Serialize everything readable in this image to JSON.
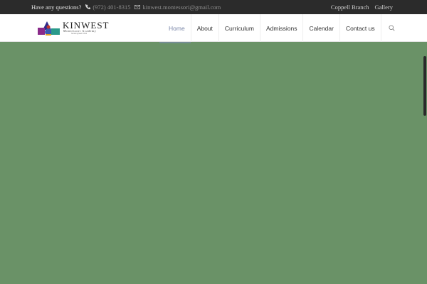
{
  "topbar": {
    "question": "Have any questions?",
    "phone": "(972) 401-8315",
    "email": "kinwest.montessori@gmail.com",
    "links": [
      "Coppell Branch",
      "Gallery"
    ],
    "phone_icon": "phone-icon",
    "email_icon": "envelope-icon"
  },
  "logo": {
    "brand": "KINWEST",
    "subtitle": "Montessori Academy",
    "tagline": "Nurturing Each Child"
  },
  "nav": {
    "items": [
      "Home",
      "About",
      "Curriculum",
      "Admissions",
      "Calendar",
      "Contact us"
    ],
    "active": "Home",
    "search_icon": "search-icon"
  },
  "colors": {
    "topbar_bg": "#2b2b2b",
    "hero_bg": "#6a9267",
    "active_nav": "#7a86a8"
  }
}
